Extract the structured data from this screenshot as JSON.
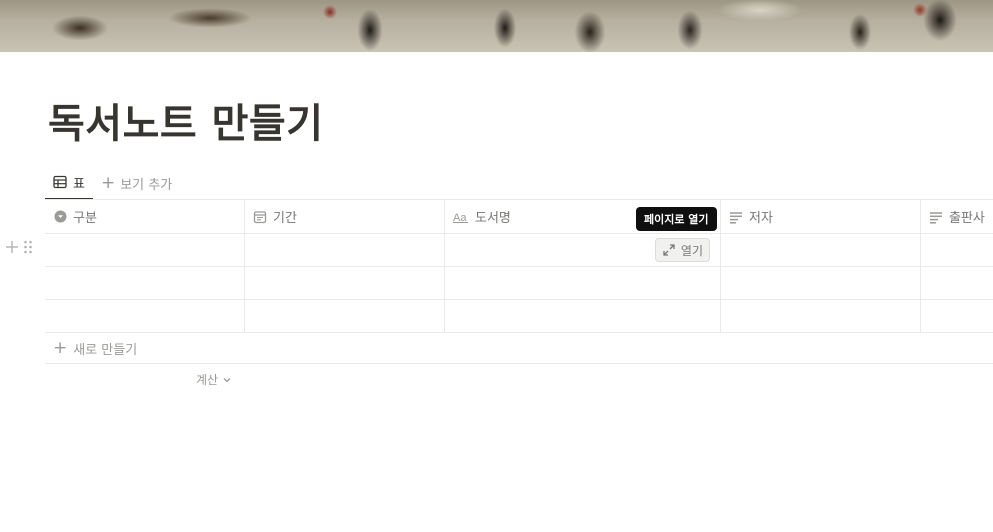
{
  "page": {
    "title": "독서노트 만들기"
  },
  "views": {
    "tabs": [
      {
        "label": "표",
        "icon": "table-icon",
        "active": true
      }
    ],
    "add_view_label": "보기 추가"
  },
  "table": {
    "columns": [
      {
        "label": "구분",
        "icon": "select-icon"
      },
      {
        "label": "기간",
        "icon": "calendar-icon"
      },
      {
        "label": "도서명",
        "icon": "title-aa-icon"
      },
      {
        "label": "저자",
        "icon": "text-lines-icon"
      },
      {
        "label": "출판사",
        "icon": "text-lines-icon"
      }
    ],
    "rows": [
      [
        "",
        "",
        "",
        "",
        ""
      ],
      [
        "",
        "",
        "",
        "",
        ""
      ],
      [
        "",
        "",
        "",
        "",
        ""
      ]
    ],
    "open_button_label": "열기",
    "tooltip": "페이지로 열기",
    "new_row_label": "새로 만들기",
    "calculate_label": "계산"
  },
  "colors": {
    "text": "#37352f",
    "muted": "#9b9a97",
    "border": "#e9e9e7",
    "tooltip_bg": "#0f0f0f"
  }
}
